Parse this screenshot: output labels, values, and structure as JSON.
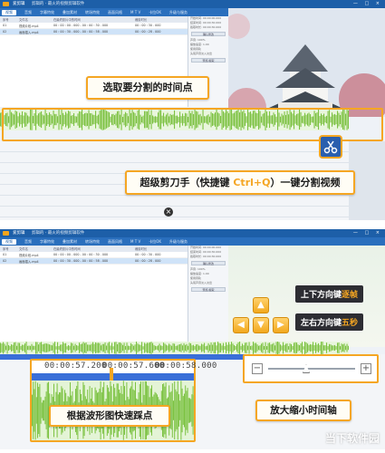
{
  "app": {
    "title": "爱剪辑",
    "subtitle": "剪辑的 · 最火的视频剪辑软件",
    "window_controls": "— □ ×"
  },
  "menu": [
    "视频",
    "音频",
    "字幕特效",
    "叠加素材",
    "转场特效",
    "画面风格",
    "M T V",
    "卡拉OK",
    "升级与服务"
  ],
  "file_table": {
    "headers": [
      "序号",
      "文件名",
      "在最终影片中的时间",
      "裁剪时长"
    ],
    "rows": [
      [
        "01",
        "视频片段.mp4",
        "00 : 00 : 00 . 000 - 00 : 00 : 30 . 000",
        "00 : 00 : 30 . 000"
      ],
      [
        "02",
        "画面插入.mp4",
        "00 : 00 : 30 . 000 - 00 : 00 : 58 . 000",
        "00 : 00 : 28 . 000"
      ]
    ]
  },
  "props": {
    "items": [
      "开始时间: 00:00:00.000",
      "结束时间: 00:00:30.000",
      "截取时长: 00:00:30.000",
      "声音: 100%",
      "播放速度: 1.00"
    ],
    "buttons": [
      "确认修改",
      "预览/截取"
    ],
    "checkboxes": [
      "使用音轨",
      "头尾声音淡入淡出"
    ]
  },
  "panel1": {
    "callout_top": "选取要分割的时间点",
    "callout_bottom_prefix": "超级剪刀手（快捷键 ",
    "callout_bottom_shortcut": "Ctrl+Q",
    "callout_bottom_suffix": "）一键分割视频",
    "scissor_icon": "scissors-icon",
    "close_icon": "close-icon"
  },
  "panel2": {
    "timecodes": [
      "00:00:57.200",
      "00:00:57.600",
      "00:00:58.000"
    ],
    "key_updown_prefix": "上下方向键",
    "key_updown_hl": "逐帧",
    "key_leftright_prefix": "左右方向键",
    "key_leftright_hl": "五秒",
    "callout_waveform": "根据波形图快速踩点",
    "callout_zoom": "放大缩小时间轴",
    "zoom_minus": "−",
    "zoom_plus": "+",
    "arrow_up": "▲",
    "arrow_down": "▼",
    "arrow_left": "◀",
    "arrow_right": "▶",
    "watermark": "当下软件园"
  },
  "colors": {
    "accent": "#f5a623",
    "brand": "#1d5fa8",
    "waveform": "#7cc242",
    "selection": "#3a6fd8"
  }
}
